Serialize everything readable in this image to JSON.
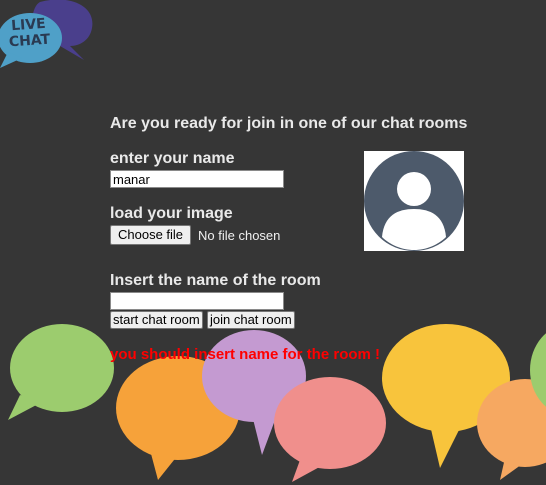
{
  "logo": {
    "line1": "LIVE",
    "line2": "CHAT"
  },
  "form": {
    "heading": "Are you ready for join in one of our chat rooms",
    "name_label": "enter your name",
    "name_value": "manar",
    "image_label": "load your image",
    "file_button_label": "Choose file",
    "file_status": "No file chosen",
    "room_label": "Insert the name of the room",
    "room_value": "",
    "start_button_label": "start chat room",
    "join_button_label": "join chat room",
    "error_message": "you should insert name for the room !"
  },
  "avatar": {
    "icon": "user-silhouette-icon"
  },
  "colors": {
    "background": "#363636",
    "error": "#ff0000",
    "text": "#e9e9e9",
    "avatar": "#4d5a6b"
  }
}
